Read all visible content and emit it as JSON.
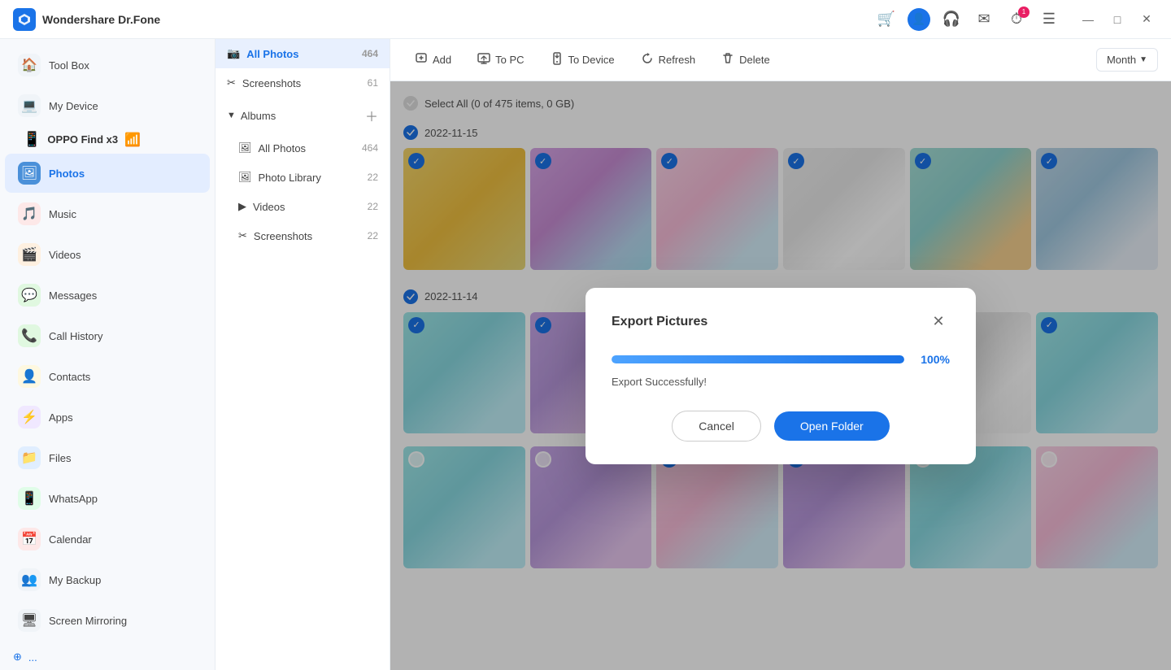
{
  "app": {
    "title": "Wondershare Dr.Fone",
    "logo_text": "W"
  },
  "titlebar": {
    "cart_icon": "🛒",
    "user_icon": "👤",
    "headphone_icon": "🎧",
    "mail_icon": "✉",
    "history_icon": "⏱",
    "menu_icon": "☰",
    "minimize": "—",
    "maximize": "□",
    "close": "✕"
  },
  "sidebar": {
    "items": [
      {
        "label": "Tool Box",
        "icon": "🏠",
        "color": "#888",
        "active": false
      },
      {
        "label": "My Device",
        "icon": "💻",
        "color": "#888",
        "active": false
      },
      {
        "label": "OPPO Find x3",
        "icon": "📱",
        "color": "#333",
        "active": false,
        "wifi": true
      },
      {
        "label": "Photos",
        "icon": "🖼",
        "color": "#4a90d9",
        "active": true,
        "iconBg": "#4a90d9"
      },
      {
        "label": "Music",
        "icon": "🎵",
        "color": "#e74c3c",
        "active": false
      },
      {
        "label": "Videos",
        "icon": "🎬",
        "color": "#e67e22",
        "active": false
      },
      {
        "label": "Messages",
        "icon": "💬",
        "color": "#27ae60",
        "active": false
      },
      {
        "label": "Call History",
        "icon": "📞",
        "color": "#27ae60",
        "active": false
      },
      {
        "label": "Contacts",
        "icon": "👤",
        "color": "#f39c12",
        "active": false
      },
      {
        "label": "Apps",
        "icon": "⚡",
        "color": "#9b59b6",
        "active": false
      },
      {
        "label": "Files",
        "icon": "📁",
        "color": "#3498db",
        "active": false
      },
      {
        "label": "WhatsApp",
        "icon": "📱",
        "color": "#25d366",
        "active": false
      },
      {
        "label": "Calendar",
        "icon": "📅",
        "color": "#e74c3c",
        "active": false
      },
      {
        "label": "My Backup",
        "icon": "👥",
        "color": "#7f8c8d",
        "active": false
      },
      {
        "label": "Screen Mirroring",
        "icon": "🖥",
        "color": "#7f8c8d",
        "active": false
      }
    ],
    "bottom_label": "..."
  },
  "photo_sidebar": {
    "all_photos_label": "All Photos",
    "all_photos_count": "464",
    "albums_label": "Albums",
    "albums_items": [
      {
        "label": "All Photos",
        "count": "464",
        "icon": "📷"
      },
      {
        "label": "Photo Library",
        "count": "22",
        "icon": "🖼"
      },
      {
        "label": "Videos",
        "count": "22",
        "icon": "▶"
      },
      {
        "label": "Screenshots",
        "count": "22",
        "icon": "✂"
      }
    ],
    "screenshots_label": "Screenshots",
    "screenshots_count": "61"
  },
  "toolbar": {
    "add_label": "Add",
    "to_pc_label": "To PC",
    "to_device_label": "To Device",
    "refresh_label": "Refresh",
    "delete_label": "Delete",
    "month_label": "Month"
  },
  "content": {
    "select_all_label": "Select All (0 of 475 items, 0 GB)",
    "date1": "2022-11-15",
    "date2": "2022-11-14",
    "photos1_checked": [
      true,
      true,
      true,
      true,
      true,
      true
    ],
    "photos2_checked": [
      true,
      true,
      true,
      true,
      true,
      true
    ],
    "photos3_checked": [
      false,
      false,
      true,
      true,
      false,
      false
    ]
  },
  "modal": {
    "title": "Export Pictures",
    "progress": 100,
    "progress_text": "100%",
    "success_text": "Export Successfully!",
    "cancel_label": "Cancel",
    "open_folder_label": "Open Folder"
  }
}
